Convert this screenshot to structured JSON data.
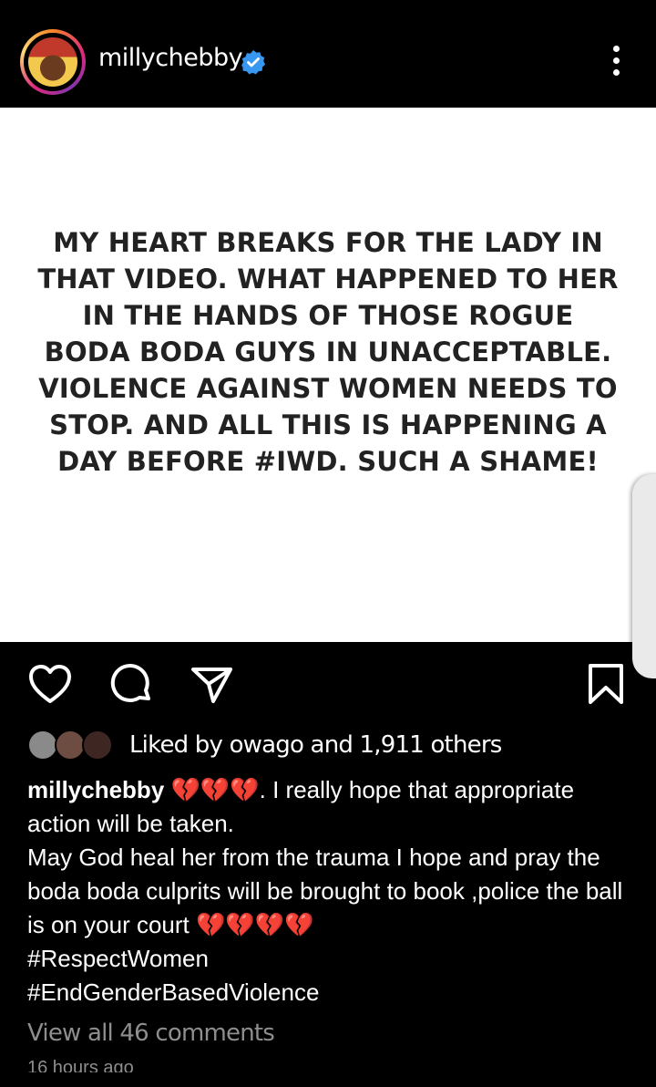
{
  "header": {
    "username": "millychebby",
    "verified_icon": "verified-badge-icon",
    "accent": "#3897f0"
  },
  "post": {
    "image_text": "MY HEART BREAKS FOR THE LADY IN THAT VIDEO. WHAT HAPPENED TO HER IN THE HANDS OF THOSE ROGUE BODA BODA GUYS IN UNACCEPTABLE. VIOLENCE AGAINST WOMEN NEEDS TO STOP. AND ALL THIS IS HAPPENING A DAY BEFORE #IWD. SUCH A SHAME!"
  },
  "actions": {
    "icons": [
      "heart-icon",
      "comment-icon",
      "share-icon",
      "bookmark-icon"
    ]
  },
  "likes": {
    "prefix": "Liked by ",
    "user": "owago",
    "middle": " and ",
    "count": "1,911 others"
  },
  "caption": {
    "username": "millychebby",
    "hearts_1": "💔💔💔",
    "text_1": ". I really hope that appropriate action will be taken.",
    "text_2": "May God heal her from the trauma I hope and pray the boda boda culprits will be brought to book ,police the ball is on your court ",
    "hearts_2": "💔💔💔💔",
    "hashtags": [
      "#RespectWomen",
      "#EndGenderBasedViolence"
    ]
  },
  "view_comments": "View all 46 comments",
  "timestamp": "16 hours ago",
  "colors": {
    "background": "#000000",
    "text": "#ffffff",
    "muted": "#8e8e8e",
    "broken_heart": "#e0243b"
  }
}
